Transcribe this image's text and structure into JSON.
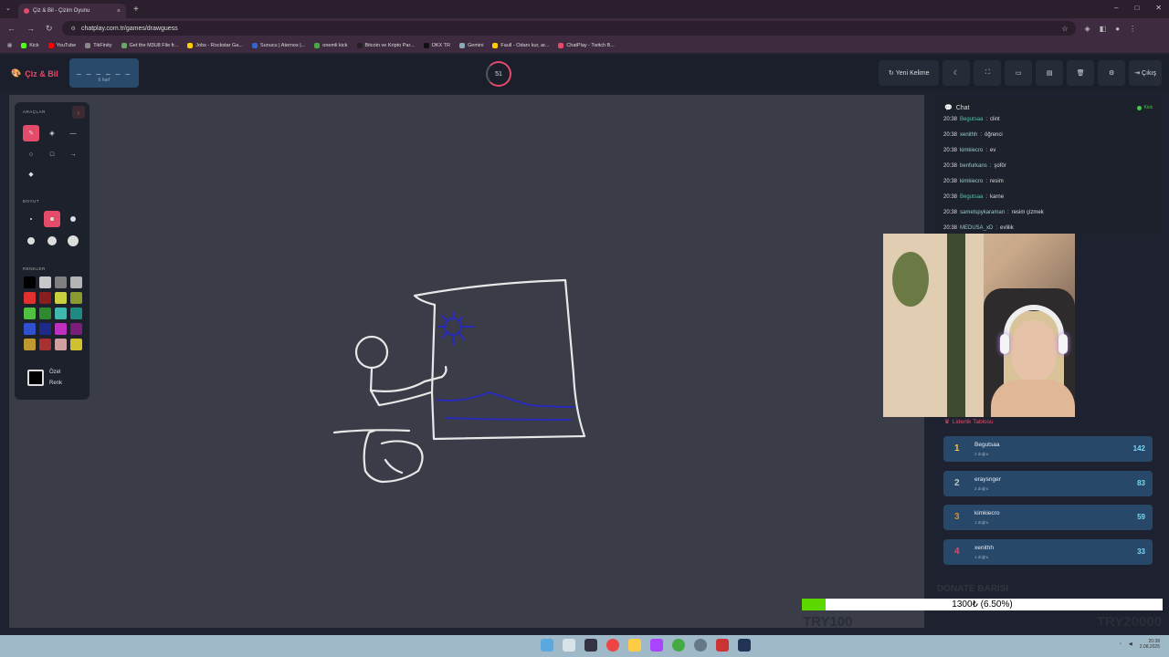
{
  "browser": {
    "tab_title": "Çiz & Bil - Çizim Oyunu",
    "url": "chatplay.com.tr/games/drawguess",
    "bookmarks": [
      "Kick",
      "YouTube",
      "TikFinity",
      "Get the M3U8 File fr...",
      "Jobs - Rockstar Ga...",
      "Sunucu | Aternos |...",
      "onemli kick",
      "Bitcoin ve Kripto Par...",
      "OKX TR",
      "Gemini",
      "Faull - Odanı kur, ar...",
      "ChatPlay - Twitch B..."
    ]
  },
  "header": {
    "logo": "Çiz & Bil",
    "word_mask": "_ _ _ _ _ _",
    "letter_count": "6 harf",
    "timer": "51",
    "new_word": "Yeni Kelime",
    "exit": "Çıkış"
  },
  "tools": {
    "tools_title": "ARAÇLAR",
    "size_title": "BOYUT",
    "colors_title": "RENKLER",
    "custom_line1": "Özel",
    "custom_line2": "Renk",
    "palette": [
      "#000000",
      "#c8c8c8",
      "#808080",
      "#b4b4b4",
      "#e03030",
      "#8a1e1e",
      "#c8d040",
      "#8a9a30",
      "#50c040",
      "#2e8a2e",
      "#40b8b0",
      "#1e8a82",
      "#3050d0",
      "#1e2a8a",
      "#c030c0",
      "#7a1e7a",
      "#c09830",
      "#a83030",
      "#d0a0a0",
      "#d0c030"
    ]
  },
  "chat": {
    "title": "Chat",
    "platform": "Kick",
    "messages": [
      {
        "time": "20:38",
        "user": "Begutsaa",
        "text": "clint"
      },
      {
        "time": "20:38",
        "user": "xenithh",
        "text": "öğrenci"
      },
      {
        "time": "20:38",
        "user": "kimkiecro",
        "text": "ev"
      },
      {
        "time": "20:38",
        "user": "benfurkans",
        "text": "şoför"
      },
      {
        "time": "20:38",
        "user": "kimkiecro",
        "text": "resim"
      },
      {
        "time": "20:38",
        "user": "Begutsaa",
        "text": "karne"
      },
      {
        "time": "20:38",
        "user": "sametspykaraman",
        "text": "resim çizmek"
      },
      {
        "time": "20:38",
        "user": "MEDUSA_xD",
        "text": "evlilik"
      }
    ]
  },
  "leaderboard": {
    "title": "Liderlik Tablosu",
    "rows": [
      {
        "rank": "1",
        "name": "Begutsaa",
        "sub": "2 doğru",
        "score": "142",
        "color": "#f5c542"
      },
      {
        "rank": "2",
        "name": "eraysnger",
        "sub": "2 doğru",
        "score": "83",
        "color": "#b8c4d0"
      },
      {
        "rank": "3",
        "name": "kimkiecro",
        "sub": "1 doğru",
        "score": "59",
        "color": "#d08a3a"
      },
      {
        "rank": "4",
        "name": "xenithh",
        "sub": "1 doğru",
        "score": "33",
        "color": "#e24b6a"
      }
    ]
  },
  "donate": {
    "title": "DONATE BARISI",
    "progress_text": "1300₺ (6.50%)",
    "progress_fraction": 0.065,
    "min": "TRY100",
    "max": "TRY20000"
  },
  "taskbar": {
    "time": "20:38",
    "date": "2.08.2025"
  }
}
